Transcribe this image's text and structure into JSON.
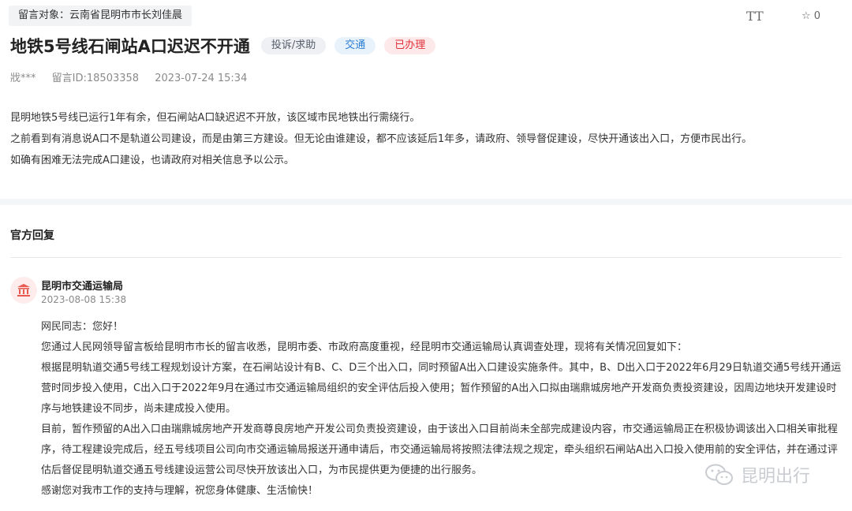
{
  "header": {
    "target_label": "留言对象：云南省昆明市市长刘佳晨",
    "font_size_icon": "font-size-icon",
    "font_size_glyph": "TT",
    "favorite_icon": "star-icon",
    "favorite_count": "0"
  },
  "message": {
    "title": "地铁5号线石闸站A口迟迟不开通",
    "tags": {
      "category": "投诉/求助",
      "field": "交通",
      "status": "已办理"
    },
    "author": "戕***",
    "message_id": "留言ID:18503358",
    "datetime": "2023-07-24 15:34",
    "paragraphs": [
      "昆明地铁5号线已运行1年有余，但石闸站A口缺迟迟不开放，该区域市民地铁出行需绕行。",
      "之前看到有消息说A口不是轨道公司建设，而是由第三方建设。但无论由谁建设，都不应该延后1年多，请政府、领导督促建设，尽快开通该出入口，方便市民出行。",
      "如确有困难无法完成A口建设，也请政府对相关信息予以公示。"
    ]
  },
  "reply": {
    "heading": "官方回复",
    "avatar_icon": "government-building-icon",
    "org_name": "昆明市交通运输局",
    "datetime": "2023-08-08 15:38",
    "paragraphs": [
      "网民同志：您好！",
      "您通过人民网领导留言板给昆明市市长的留言收悉，昆明市委、市政府高度重视，经昆明市交通运输局认真调查处理，现将有关情况回复如下：",
      "根据昆明轨道交通5号线工程规划设计方案，在石闸站设计有B、C、D三个出入口，同时预留A出入口建设实施条件。其中，B、D出入口于2022年6月29日轨道交通5号线开通运营时同步投入使用，C出入口于2022年9月在通过市交通运输局组织的安全评估后投入使用；暂作预留的A出入口拟由瑞鼎城房地产开发商负责投资建设，因周边地块开发建设时序与地铁建设不同步，尚未建成投入使用。",
      "目前，暂作预留的A出入口由瑞鼎城房地产开发商尊良房地产开发公司负责投资建设，由于该出入口目前尚未全部完成建设内容，市交通运输局正在积极协调该出入口相关审批程序，待工程建设完成后，经五号线项目公司向市交通运输局报送开通申请后，市交通运输局将按照法律法规之规定，牵头组织石闸站A出入口投入使用前的安全评估，并在通过评估后督促昆明轨道交通五号线建设运营公司尽快开放该出入口，为市民提供更为便捷的出行服务。",
      "感谢您对我市工作的支持与理解，祝您身体健康、生活愉快！"
    ]
  },
  "watermark": {
    "icon": "wechat-icon",
    "text": "昆明出行"
  },
  "colors": {
    "status_red": "#e0303a",
    "field_blue": "#2d7fd3",
    "avatar_red": "#e85a4f"
  }
}
